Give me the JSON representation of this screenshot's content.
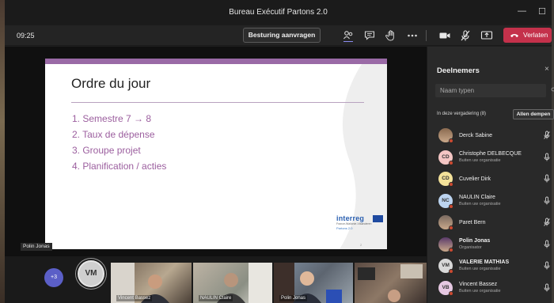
{
  "window": {
    "title": "Bureau Exécutif Partons 2.0",
    "minimize": "—",
    "maximize": "☐"
  },
  "toolbar": {
    "time": "09:25",
    "control_label": "Besturing aanvragen",
    "leave_label": "Verlaten"
  },
  "slide": {
    "title": "Ordre du jour",
    "items": [
      "1.  Semestre 7 → 8",
      "2.  Taux de dépense",
      "3.  Groupe projet",
      "4.  Planification / acties"
    ],
    "logo": "interreg",
    "logo_sub": "France-Wallonie-Vlaanderen",
    "logo_sub2": "Partons 2.0",
    "page": "2"
  },
  "presenter_tag": "Polin Jonas",
  "strip": {
    "more": "+3",
    "self_initials": "VM",
    "tiles": [
      {
        "label": "Vincent Bassez"
      },
      {
        "label": "NAULIN Claire"
      },
      {
        "label": "Polin Jonas"
      }
    ]
  },
  "panel": {
    "title": "Deelnemers",
    "close": "×",
    "search_placeholder": "Naam typen",
    "section": "In deze vergadering (8)",
    "mute_all": "Allen dempen",
    "participants": [
      {
        "name": "Derck Sabine",
        "sub": "",
        "initials": "",
        "photo": true,
        "avatar_color": "#8a6a50",
        "mic": "muted"
      },
      {
        "name": "Christophe DELBECQUE",
        "sub": "Buiten uw organisatie",
        "initials": "CD",
        "photo": false,
        "avatar_color": "#f4c6c4",
        "mic": "on"
      },
      {
        "name": "Cuvelier Dirk",
        "sub": "",
        "initials": "CD",
        "photo": false,
        "avatar_color": "#f4e29a",
        "mic": "on"
      },
      {
        "name": "NAULIN Claire",
        "sub": "Buiten uw organisatie",
        "initials": "NC",
        "photo": false,
        "avatar_color": "#bcd4f0",
        "mic": "on"
      },
      {
        "name": "Paret Bern",
        "sub": "",
        "initials": "",
        "photo": true,
        "avatar_color": "#7a6a60",
        "mic": "muted"
      },
      {
        "name": "Polin Jonas",
        "sub": "Organisator",
        "initials": "",
        "photo": true,
        "avatar_color": "#5a3a6a",
        "mic": "on"
      },
      {
        "name": "VALERIE MATHIAS",
        "sub": "Buiten uw organisatie",
        "initials": "VM",
        "photo": false,
        "avatar_color": "#d8d8d8",
        "mic": "on"
      },
      {
        "name": "Vincent Bassez",
        "sub": "Buiten uw organisatie",
        "initials": "VB",
        "photo": false,
        "avatar_color": "#e6c8e2",
        "mic": "on"
      }
    ]
  },
  "colors": {
    "accent_purple": "#9b5e9e",
    "leave_red": "#c4314b",
    "teams_blue": "#5b5fc7"
  }
}
